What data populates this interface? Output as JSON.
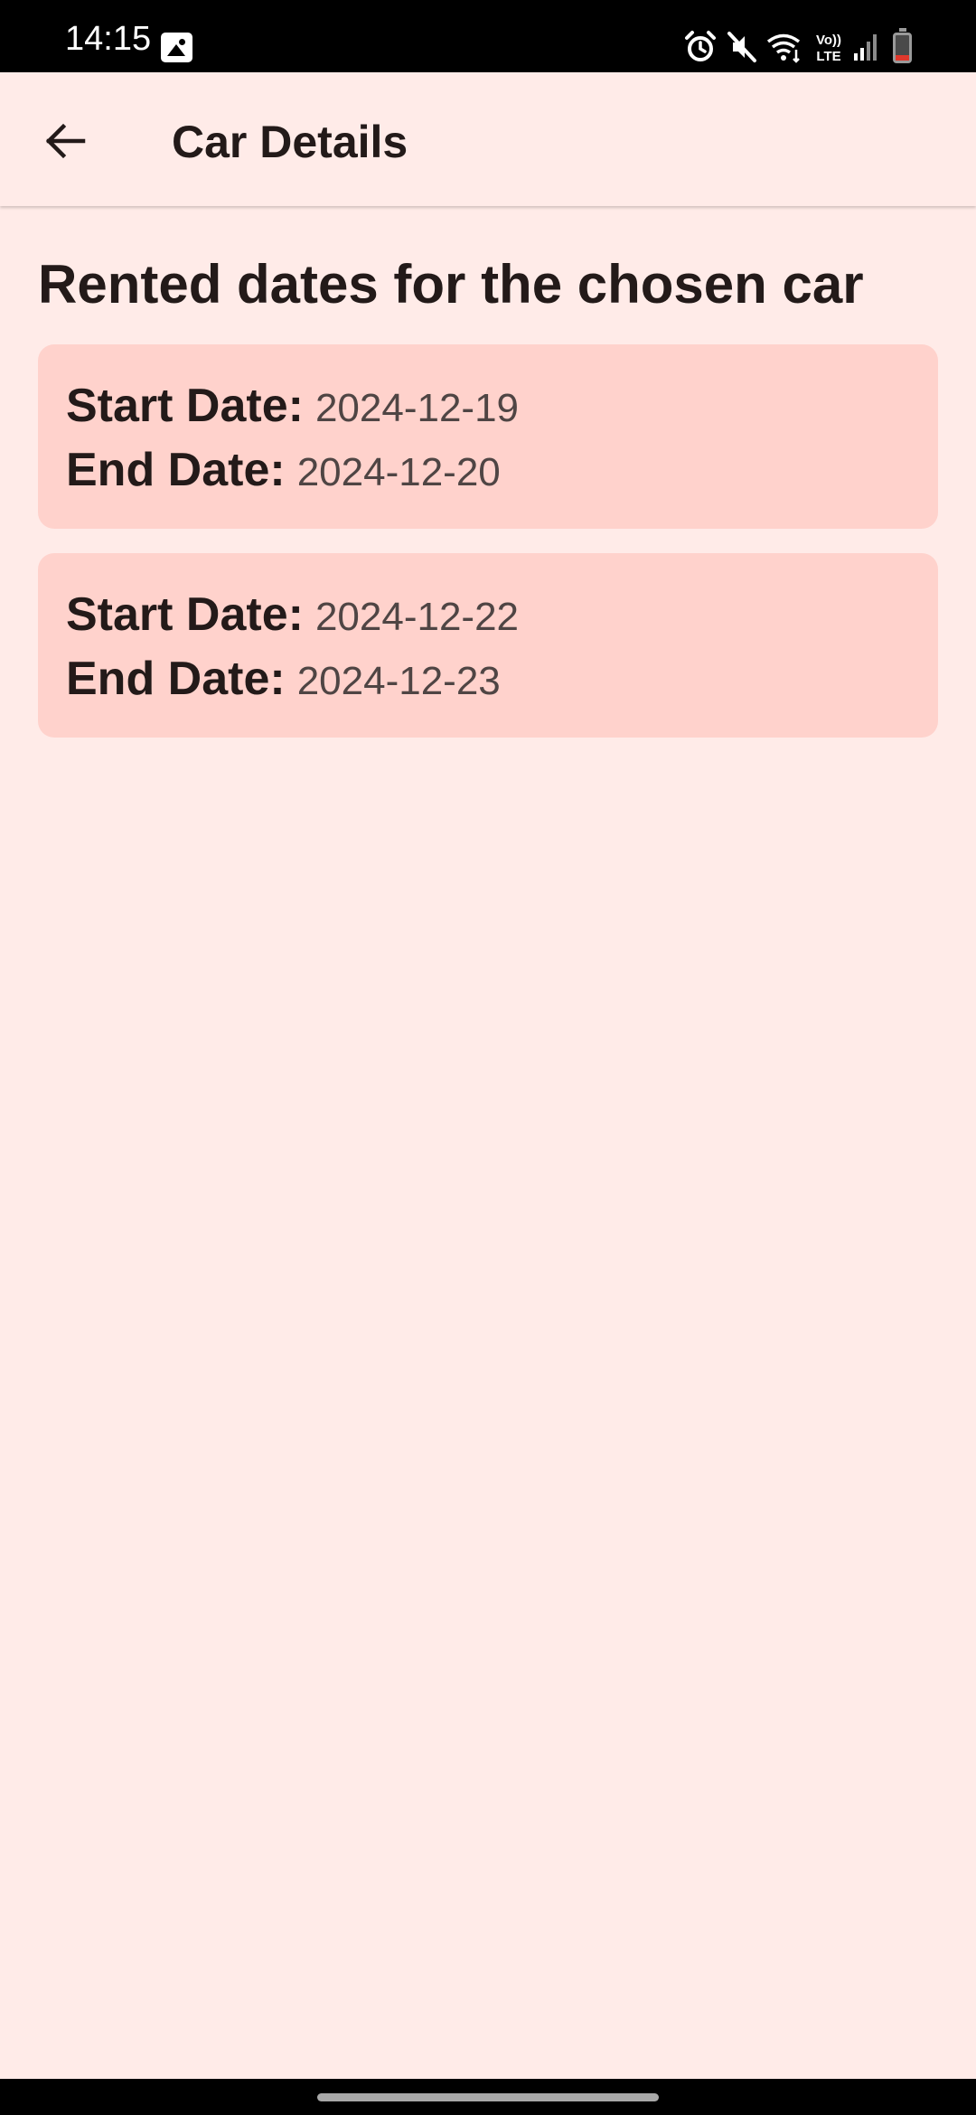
{
  "status_bar": {
    "time": "14:15",
    "icons": [
      "gallery-icon",
      "alarm-icon",
      "mute-icon",
      "wifi-icon",
      "volte-icon",
      "signal-icon",
      "battery-icon"
    ],
    "volte_line1": "Vo))",
    "volte_line2": "LTE"
  },
  "app_bar": {
    "title": "Car Details",
    "back_icon": "arrow-back-icon"
  },
  "main": {
    "heading": "Rented dates for the chosen car",
    "start_label": "Start Date:",
    "end_label": "End Date:",
    "rentals": [
      {
        "start": "2024-12-19",
        "end": "2024-12-20"
      },
      {
        "start": "2024-12-22",
        "end": "2024-12-23"
      }
    ]
  },
  "colors": {
    "background": "#ffebe8",
    "card": "#ffd2cc",
    "text": "#231a19",
    "muted_text": "#4f4544",
    "status_bar": "#000000"
  }
}
